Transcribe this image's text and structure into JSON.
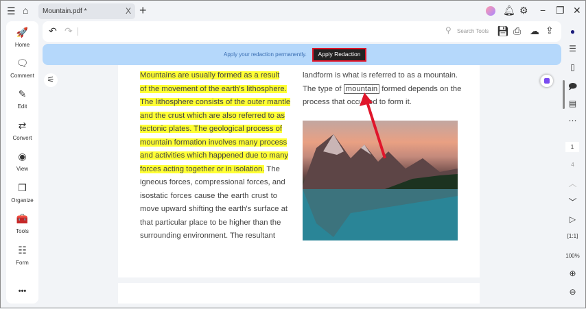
{
  "titlebar": {
    "tab_title": "Mountain.pdf *",
    "close": "X",
    "new_tab": "+",
    "minimize": "−",
    "restore": "❐",
    "close_window": "✕"
  },
  "sidebar": {
    "items": [
      {
        "label": "Home",
        "icon": "🚀"
      },
      {
        "label": "Comment",
        "icon": "🗨"
      },
      {
        "label": "Edit",
        "icon": "✎"
      },
      {
        "label": "Convert",
        "icon": "⇄"
      },
      {
        "label": "View",
        "icon": "◉"
      },
      {
        "label": "Organize",
        "icon": "❒"
      },
      {
        "label": "Tools",
        "icon": "🧰"
      },
      {
        "label": "Form",
        "icon": "☷"
      }
    ],
    "more": "•••"
  },
  "toolbar": {
    "search_placeholder": "Search Tools"
  },
  "banner": {
    "message": "Apply your redaction permanently.",
    "button": "Apply Redaction"
  },
  "document": {
    "left_lines": [
      [
        {
          "t": "Mountains are usually formed as a result",
          "h": true
        }
      ],
      [
        {
          "t": "of the movement of the earth's lithosphere.",
          "h": true
        }
      ],
      [
        {
          "t": "The lithosphere consists of the outer mantle",
          "h": true
        }
      ],
      [
        {
          "t": "and the crust which are also referred to as",
          "h": true
        }
      ],
      [
        {
          "t": "tectonic plates. The geological process of",
          "h": true
        }
      ],
      [
        {
          "t": "mountain formation involves many process",
          "h": true
        }
      ],
      [
        {
          "t": "and activities which happened due to many",
          "h": true
        }
      ],
      [
        {
          "t": "forces acting together or in isolation.",
          "h": true
        },
        {
          "t": " The",
          "h": false
        }
      ],
      [
        {
          "t": "igneous forces, compressional forces, and",
          "h": false
        }
      ],
      [
        {
          "t": "isostatic forces cause the earth crust to",
          "h": false
        }
      ],
      [
        {
          "t": "move upward shifting the earth's surface at",
          "h": false
        }
      ],
      [
        {
          "t": "that particular place to be higher than the",
          "h": false
        }
      ],
      [
        {
          "t": "surrounding environment. The resultant",
          "h": false
        }
      ]
    ],
    "right_line1": "landform is what is referred to as a mountain.",
    "right_line2_pre": "The type of ",
    "right_line2_boxed": "mountain",
    "right_line2_post": " formed depends on the",
    "right_line3": "process that occurred to form it."
  },
  "right_panel": {
    "page_current": "1",
    "page_total": "4",
    "zoom": "100%"
  }
}
